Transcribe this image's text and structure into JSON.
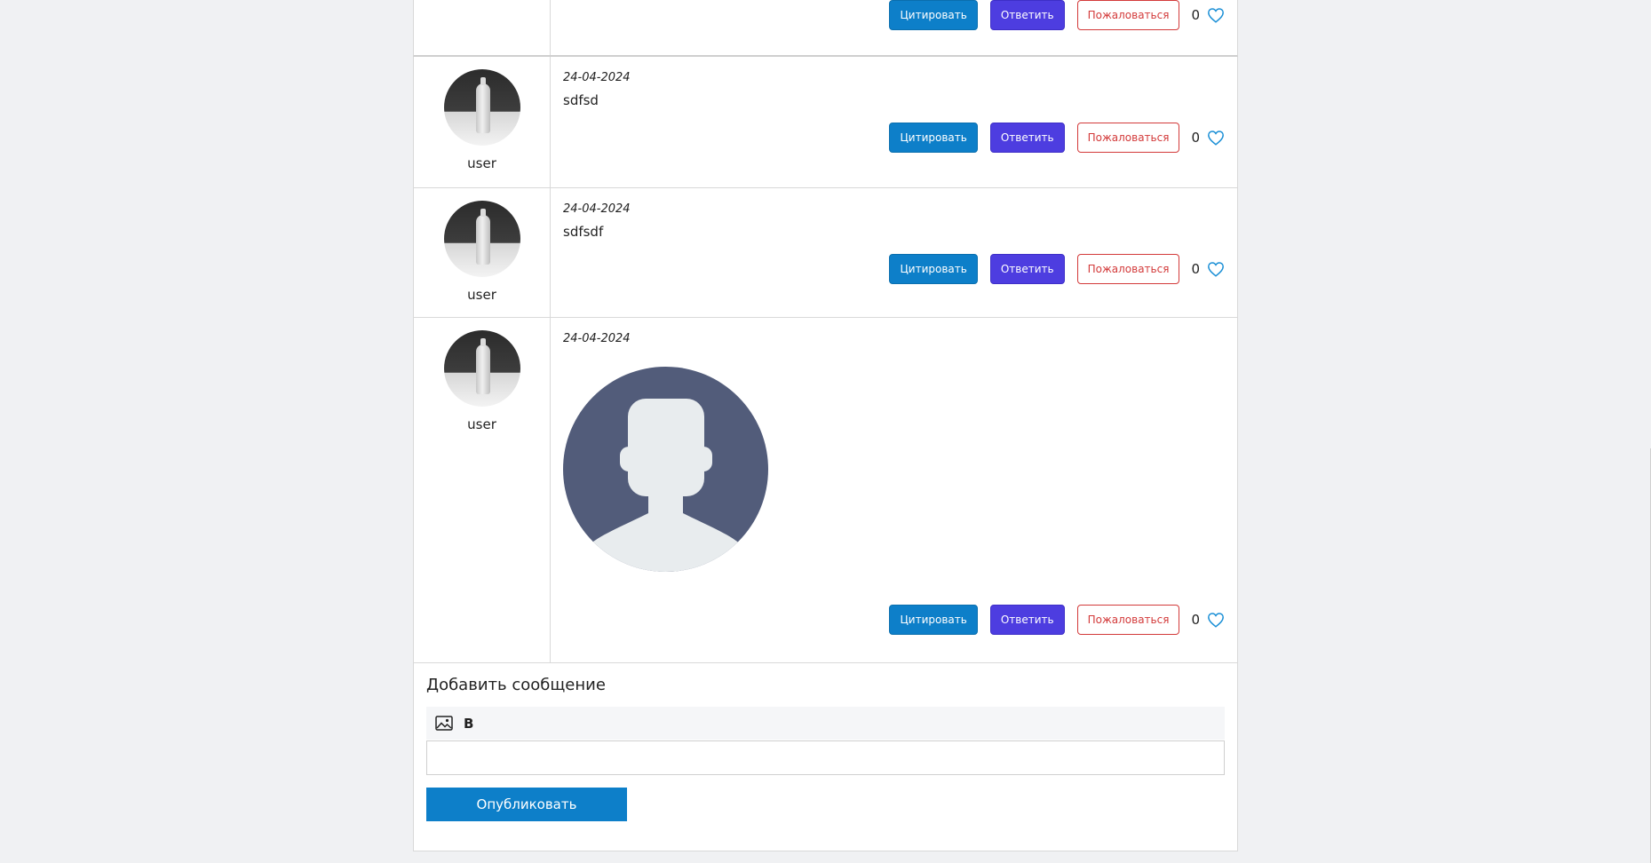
{
  "posts": [
    {
      "author": "",
      "date": "",
      "text": "",
      "actions": {
        "quote": "Цитировать",
        "reply": "Ответить",
        "report": "Пожаловаться"
      },
      "likes": "0"
    },
    {
      "author": "user",
      "date": "24-04-2024",
      "text": "sdfsd",
      "actions": {
        "quote": "Цитировать",
        "reply": "Ответить",
        "report": "Пожаловаться"
      },
      "likes": "0"
    },
    {
      "author": "user",
      "date": "24-04-2024",
      "text": "sdfsdf",
      "actions": {
        "quote": "Цитировать",
        "reply": "Ответить",
        "report": "Пожаловаться"
      },
      "likes": "0"
    },
    {
      "author": "user",
      "date": "24-04-2024",
      "text": "",
      "attachment": "default-user-avatar-image",
      "actions": {
        "quote": "Цитировать",
        "reply": "Ответить",
        "report": "Пожаловаться"
      },
      "likes": "0"
    }
  ],
  "composer": {
    "title": "Добавить сообщение",
    "toolbar": {
      "image_icon": "image-icon",
      "bold_label": "B"
    },
    "input_value": "",
    "publish_label": "Опубликовать"
  },
  "colors": {
    "quote": "#0d7fc9",
    "reply": "#4d3de0",
    "report": "#d33a3a",
    "like_heart": "#1a8fd6",
    "avatar_placeholder": "#525c7a"
  }
}
